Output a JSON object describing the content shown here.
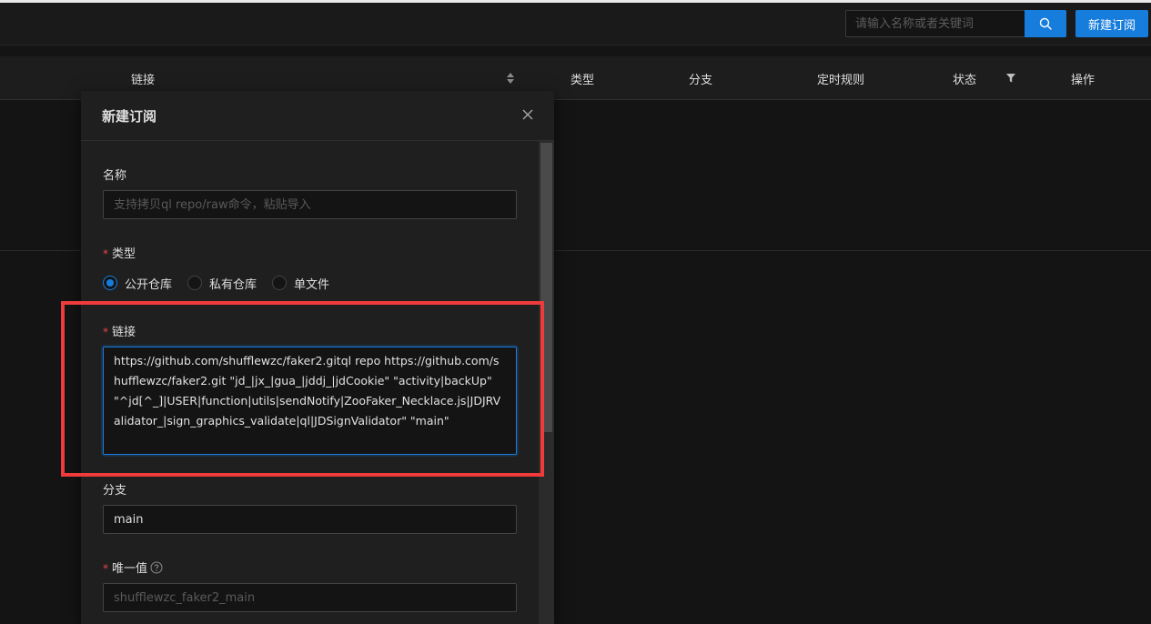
{
  "toolbar": {
    "search_placeholder": "请输入名称或者关键词",
    "new_button_label": "新建订阅",
    "search_icon": "search-icon"
  },
  "table": {
    "columns": [
      {
        "label": "链接",
        "icon": "sort-icon"
      },
      {
        "label": "类型"
      },
      {
        "label": "分支"
      },
      {
        "label": "定时规则"
      },
      {
        "label": "状态",
        "icon": "filter-icon"
      },
      {
        "label": "操作"
      }
    ]
  },
  "modal": {
    "title": "新建订阅",
    "close_icon": "close-icon",
    "name_label": "名称",
    "name_placeholder": "支持拷贝ql repo/raw命令，粘贴导入",
    "type_label": "类型",
    "type_options": [
      {
        "label": "公开仓库",
        "checked": true
      },
      {
        "label": "私有仓库",
        "checked": false
      },
      {
        "label": "单文件",
        "checked": false
      }
    ],
    "url_label": "链接",
    "url_value": "https://github.com/shufflewzc/faker2.gitql repo https://github.com/shufflewzc/faker2.git \"jd_|jx_|gua_|jddj_|jdCookie\" \"activity|backUp\" \"^jd[^_]|USER|function|utils|sendNotify|ZooFaker_Necklace.js|JDJRValidator_|sign_graphics_validate|ql|JDSignValidator\" \"main\"",
    "branch_label": "分支",
    "branch_value": "main",
    "alias_label": "唯一值",
    "alias_value": "shufflewzc_faker2_main"
  },
  "colors": {
    "accent": "#177ddc",
    "required": "#e84749",
    "highlight": "#ef3b3b",
    "background": "#141414",
    "modal_bg": "#1f1f1f"
  }
}
